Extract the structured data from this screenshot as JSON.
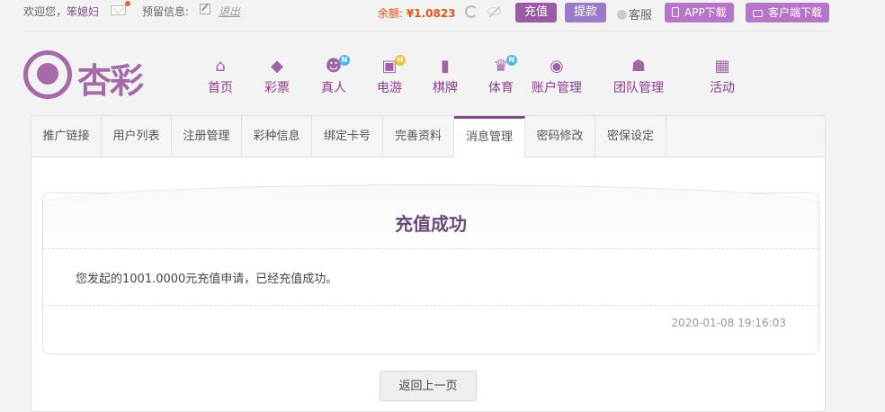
{
  "topbar": {
    "welcome_prefix": "欢迎您，",
    "username": "笨媳妇",
    "msg_label": "预留信息:",
    "logout": "退出",
    "balance_label": "余额:",
    "balance_value": "¥1.0823",
    "recharge": "充值",
    "withdraw": "提款",
    "service": "客服",
    "app_download": "APP下载",
    "client_download": "客户端下载"
  },
  "logo": {
    "name": "杏彩"
  },
  "nav": [
    {
      "label": "首页",
      "icon": "home-icon",
      "glyph": "⌂"
    },
    {
      "label": "彩票",
      "icon": "ticket-icon",
      "glyph": "◆"
    },
    {
      "label": "真人",
      "icon": "dealer-icon",
      "glyph": "☻",
      "badge": "N"
    },
    {
      "label": "电游",
      "icon": "gamepad-icon",
      "glyph": "▣",
      "badge": "H"
    },
    {
      "label": "棋牌",
      "icon": "cards-icon",
      "glyph": "▮"
    },
    {
      "label": "体育",
      "icon": "trophy-icon",
      "glyph": "♛",
      "badge": "N"
    },
    {
      "label": "账户管理",
      "icon": "account-icon",
      "glyph": "◉"
    },
    {
      "label": "团队管理",
      "icon": "team-icon",
      "glyph": "☗"
    },
    {
      "label": "活动",
      "icon": "gift-icon",
      "glyph": "▦"
    }
  ],
  "tabs": [
    "推广链接",
    "用户列表",
    "注册管理",
    "彩种信息",
    "绑定卡号",
    "完善资料",
    "消息管理",
    "密码修改",
    "密保设定"
  ],
  "active_tab": "消息管理",
  "message": {
    "title": "充值成功",
    "content": "您发起的1001.0000元充值申请，已经充值成功。",
    "time": "2020-01-08 19:16:03"
  },
  "back_button": "返回上一页",
  "colors": {
    "brand": "#a66aa8",
    "balance": "#e0531f",
    "active_tab": "#7d4f8a"
  }
}
